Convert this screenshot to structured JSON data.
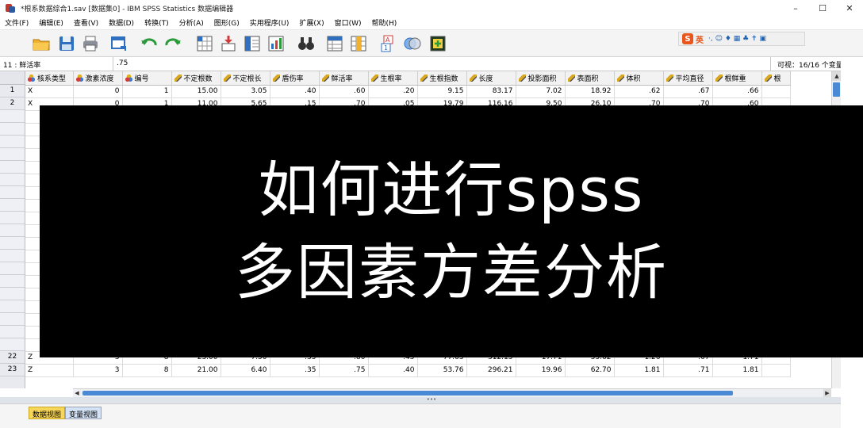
{
  "window": {
    "title": "*根系数据综合1.sav [数据集0] - IBM SPSS Statistics 数据编辑器",
    "min_glyph": "–",
    "max_glyph": "☐",
    "close_glyph": "✕"
  },
  "menu": [
    {
      "label": "文件(F)"
    },
    {
      "label": "编辑(E)"
    },
    {
      "label": "查看(V)"
    },
    {
      "label": "数据(D)"
    },
    {
      "label": "转换(T)"
    },
    {
      "label": "分析(A)"
    },
    {
      "label": "图形(G)"
    },
    {
      "label": "实用程序(U)"
    },
    {
      "label": "扩展(X)"
    },
    {
      "label": "窗口(W)"
    },
    {
      "label": "帮助(H)"
    }
  ],
  "ime": {
    "logo": "S",
    "lang": "英",
    "icons": "·, ☺ ♦ ▦ ♣ ✝ ▣"
  },
  "cellbar": {
    "ref": "11 : 鲜活率",
    "value": ".75",
    "visible": "可视：16/16 个变量"
  },
  "columns": [
    {
      "name": "核系类型",
      "icon": "nominal"
    },
    {
      "name": "激素浓度",
      "icon": "nominal"
    },
    {
      "name": "编号",
      "icon": "nominal"
    },
    {
      "name": "不定根数",
      "icon": "scale"
    },
    {
      "name": "不定根长",
      "icon": "scale"
    },
    {
      "name": "盾伤率",
      "icon": "scale"
    },
    {
      "name": "鲜活率",
      "icon": "scale"
    },
    {
      "name": "生根率",
      "icon": "scale"
    },
    {
      "name": "生根指数",
      "icon": "scale"
    },
    {
      "name": "长度",
      "icon": "scale"
    },
    {
      "name": "投影面积",
      "icon": "scale"
    },
    {
      "name": "表面积",
      "icon": "scale"
    },
    {
      "name": "体积",
      "icon": "scale"
    },
    {
      "name": "平均直径",
      "icon": "scale"
    },
    {
      "name": "根鲜重",
      "icon": "scale"
    },
    {
      "name": "根",
      "icon": "scale"
    }
  ],
  "rows": [
    {
      "n": "1",
      "cells": [
        "X",
        "0",
        "1",
        "15.00",
        "3.05",
        ".40",
        ".60",
        ".20",
        "9.15",
        "83.17",
        "7.02",
        "18.92",
        ".62",
        ".67",
        ".66",
        ""
      ]
    },
    {
      "n": "2",
      "cells": [
        "X",
        "0",
        "1",
        "11.00",
        "5.65",
        ".15",
        ".70",
        ".05",
        "19.79",
        "116.16",
        "9.50",
        "26.10",
        ".70",
        ".70",
        ".60",
        ""
      ]
    },
    {
      "n": "",
      "cells": [
        "",
        "",
        "",
        "",
        "",
        "",
        "",
        "",
        "",
        "",
        "",
        "",
        "",
        "",
        "",
        ""
      ]
    },
    {
      "n": "",
      "cells": [
        "",
        "",
        "",
        "",
        "",
        "",
        "",
        "",
        "",
        "",
        "",
        "",
        "",
        "",
        "",
        ""
      ]
    },
    {
      "n": "",
      "cells": [
        "",
        "",
        "",
        "",
        "",
        "",
        "",
        "",
        "",
        "",
        "",
        "",
        "",
        "",
        "",
        ""
      ]
    },
    {
      "n": "",
      "cells": [
        "",
        "",
        "",
        "",
        "",
        "",
        "",
        "",
        "",
        "",
        "",
        "",
        "",
        "",
        "",
        ""
      ]
    },
    {
      "n": "",
      "cells": [
        "",
        "",
        "",
        "",
        "",
        "",
        "",
        "",
        "",
        "",
        "",
        "",
        "",
        "",
        "",
        ""
      ]
    },
    {
      "n": "",
      "cells": [
        "",
        "",
        "",
        "",
        "",
        "",
        "",
        "",
        "",
        "",
        "",
        "",
        "",
        "",
        "",
        ""
      ]
    },
    {
      "n": "",
      "cells": [
        "",
        "",
        "",
        "",
        "",
        "",
        "",
        "",
        "",
        "",
        "",
        "",
        "",
        "",
        "",
        ""
      ]
    },
    {
      "n": "",
      "cells": [
        "",
        "",
        "",
        "",
        "",
        "",
        "",
        "",
        "",
        "",
        "",
        "",
        "",
        "",
        "",
        ""
      ]
    },
    {
      "n": "",
      "cells": [
        "",
        "",
        "",
        "",
        "",
        "",
        "",
        "",
        "",
        "",
        "",
        "",
        "",
        "",
        "",
        ""
      ]
    },
    {
      "n": "",
      "cells": [
        "",
        "",
        "",
        "",
        "",
        "",
        "",
        "",
        "",
        "",
        "",
        "",
        "",
        "",
        "",
        ""
      ]
    },
    {
      "n": "",
      "cells": [
        "",
        "",
        "",
        "",
        "",
        "",
        "",
        "",
        "",
        "",
        "",
        "",
        "",
        "",
        "",
        ""
      ]
    },
    {
      "n": "",
      "cells": [
        "",
        "",
        "",
        "",
        "",
        "",
        "",
        "",
        "",
        "",
        "",
        "",
        "",
        "",
        "",
        ""
      ]
    },
    {
      "n": "",
      "cells": [
        "",
        "",
        "",
        "",
        "",
        "",
        "",
        "",
        "",
        "",
        "",
        "",
        "",
        "",
        "",
        ""
      ]
    },
    {
      "n": "",
      "cells": [
        "",
        "",
        "",
        "",
        "",
        "",
        "",
        "",
        "",
        "",
        "",
        "",
        "",
        "",
        "",
        ""
      ]
    },
    {
      "n": "",
      "cells": [
        "",
        "",
        "",
        "",
        "",
        "",
        "",
        "",
        "",
        "",
        "",
        "",
        "",
        "",
        "",
        ""
      ]
    },
    {
      "n": "",
      "cells": [
        "",
        "",
        "",
        "",
        "",
        "",
        "",
        "",
        "",
        "",
        "",
        "",
        "",
        "",
        "",
        ""
      ]
    },
    {
      "n": "",
      "cells": [
        "",
        "",
        "",
        "",
        "",
        "",
        "",
        "",
        "",
        "",
        "",
        "",
        "",
        "",
        "",
        ""
      ]
    },
    {
      "n": "",
      "cells": [
        "",
        "",
        "",
        "",
        "",
        "",
        "",
        "",
        "",
        "",
        "",
        "",
        "",
        "",
        "",
        ""
      ]
    },
    {
      "n": "",
      "cells": [
        "",
        "",
        "",
        "",
        "",
        "",
        "",
        "",
        "",
        "",
        "",
        "",
        "",
        "",
        "",
        ""
      ]
    },
    {
      "n": "22",
      "cells": [
        "Z",
        "3",
        "8",
        "23.00",
        "7.50",
        ".35",
        ".80",
        ".45",
        "77.63",
        "312.15",
        "17.71",
        "55.62",
        "1.26",
        ".67",
        "1.71",
        ""
      ]
    },
    {
      "n": "23",
      "cells": [
        "Z",
        "3",
        "8",
        "21.00",
        "6.40",
        ".35",
        ".75",
        ".40",
        "53.76",
        "296.21",
        "19.96",
        "62.70",
        "1.81",
        ".71",
        "1.81",
        ""
      ]
    }
  ],
  "tabs": {
    "data_view": "数据视图",
    "variable_view": "变量视图"
  },
  "overlay": {
    "line1": "如何进行spss",
    "line2": "多因素方差分析"
  },
  "colors": {
    "overlay_bg": "#000000",
    "active_tab": "#f7d65a",
    "scroll_thumb": "#4a8ad4"
  }
}
